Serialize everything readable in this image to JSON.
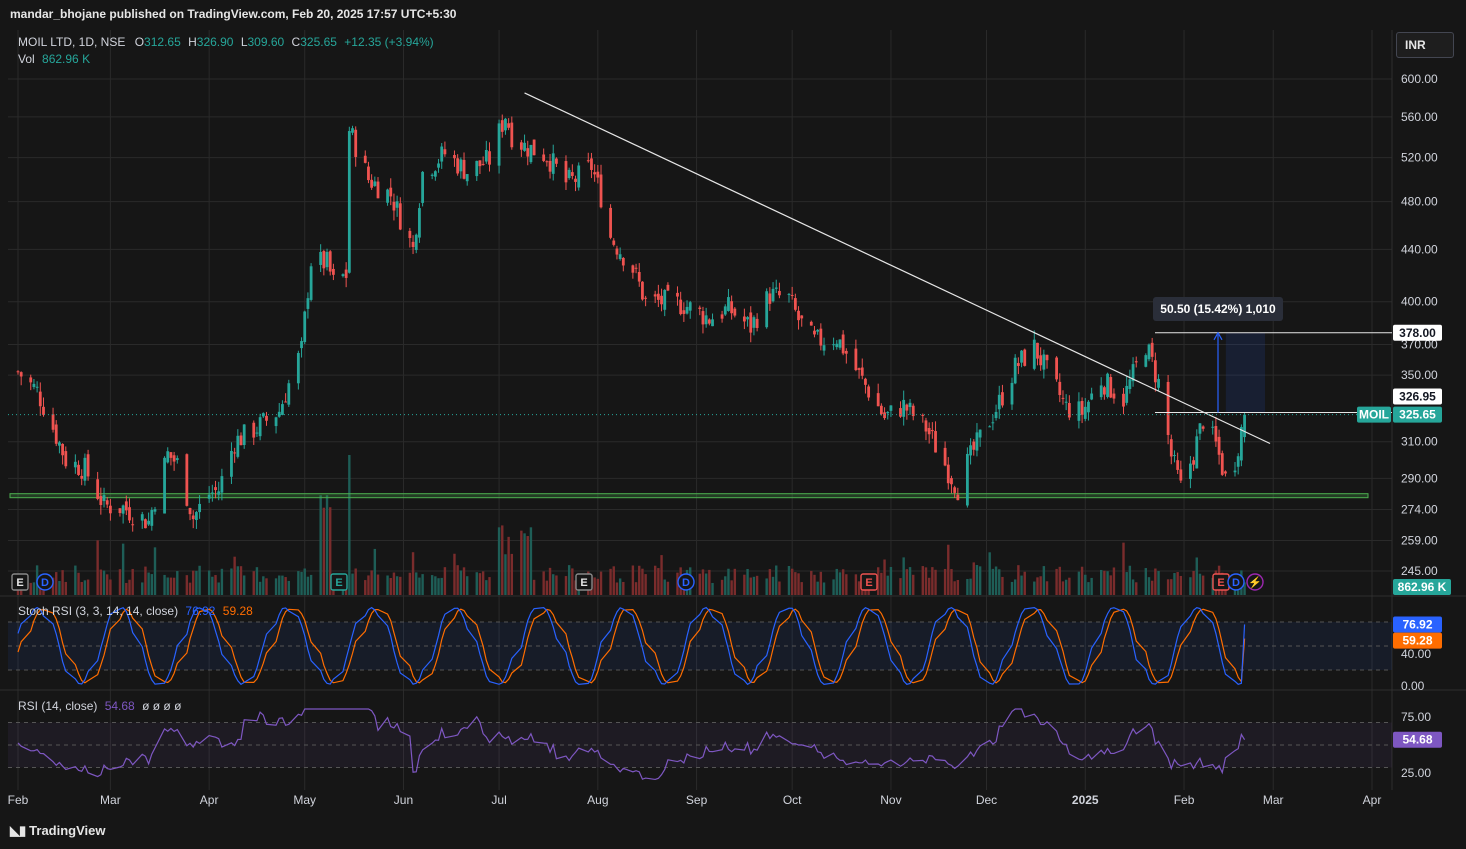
{
  "header": {
    "publisher": "mandar_bhojane published on TradingView.com, Feb 20, 2025 17:57 UTC+5:30",
    "symbol": "MOIL LTD, 1D, NSE",
    "o_label": "O",
    "o": "312.65",
    "h_label": "H",
    "h": "326.90",
    "l_label": "L",
    "l": "309.60",
    "c_label": "C",
    "c": "325.65",
    "change": "+12.35 (+3.94%)",
    "vol_label": "Vol",
    "vol": "862.96 K",
    "currency": "INR"
  },
  "colors": {
    "bg": "#161616",
    "up": "#26a69a",
    "down": "#ef5350",
    "grid": "#2a2a2a",
    "trendline": "#e6e6e6",
    "support": "#4caf50",
    "stoch_k": "#2962ff",
    "stoch_d": "#ff6d00",
    "rsi": "#7e57c2",
    "measure": "#2962ff"
  },
  "annotations": {
    "measure_label": "50.50 (15.42%) 1,010",
    "target_tag": "378.00",
    "entry_tag": "326.95",
    "symbol_tag": "MOIL",
    "last_price_tag": "325.65",
    "volume_tag": "862.96 K"
  },
  "event_markers": [
    "E",
    "D",
    "E",
    "E",
    "D",
    "E",
    "E",
    "D",
    "⚡"
  ],
  "indicators": {
    "stoch": {
      "title": "Stoch RSI (3, 3, 14, 14, close)",
      "k": "76.92",
      "d": "59.28",
      "axis": [
        "80.00",
        "40.00",
        "0.00"
      ]
    },
    "rsi": {
      "title": "RSI (14, close)",
      "value": "54.68",
      "extra": "ø ø ø ø",
      "axis": [
        "75.00",
        "25.00"
      ]
    }
  },
  "footer": {
    "brand": "TradingView"
  },
  "chart_data": {
    "type": "candlestick",
    "title": "MOIL LTD, 1D, NSE",
    "x_labels": [
      "Feb",
      "Mar",
      "Apr",
      "May",
      "Jun",
      "Jul",
      "Aug",
      "Sep",
      "Oct",
      "Nov",
      "Dec",
      "2025",
      "Feb",
      "Mar",
      "Apr"
    ],
    "y_axis_log": true,
    "y_ticks": [
      "600.00",
      "560.00",
      "520.00",
      "480.00",
      "440.00",
      "400.00",
      "370.00",
      "350.00",
      "310.00",
      "290.00",
      "274.00",
      "259.00",
      "245.00"
    ],
    "close_path": [
      [
        "2024-02-01",
        352
      ],
      [
        "2024-02-07",
        340
      ],
      [
        "2024-02-12",
        318
      ],
      [
        "2024-02-16",
        300
      ],
      [
        "2024-02-22",
        295
      ],
      [
        "2024-02-28",
        276
      ],
      [
        "2024-03-05",
        275
      ],
      [
        "2024-03-13",
        268
      ],
      [
        "2024-03-19",
        303
      ],
      [
        "2024-03-22",
        298
      ],
      [
        "2024-03-27",
        270
      ],
      [
        "2024-04-01",
        282
      ],
      [
        "2024-04-04",
        284
      ],
      [
        "2024-04-09",
        310
      ],
      [
        "2024-04-16",
        318
      ],
      [
        "2024-04-23",
        328
      ],
      [
        "2024-04-30",
        366
      ],
      [
        "2024-05-03",
        431
      ],
      [
        "2024-05-08",
        429
      ],
      [
        "2024-05-10",
        414
      ],
      [
        "2024-05-14",
        420
      ],
      [
        "2024-05-15",
        547
      ],
      [
        "2024-05-21",
        500
      ],
      [
        "2024-05-28",
        486
      ],
      [
        "2024-06-04",
        440
      ],
      [
        "2024-06-07",
        506
      ],
      [
        "2024-06-14",
        524
      ],
      [
        "2024-06-21",
        507
      ],
      [
        "2024-06-28",
        518
      ],
      [
        "2024-07-03",
        562
      ],
      [
        "2024-07-05",
        542
      ],
      [
        "2024-07-09",
        531
      ],
      [
        "2024-07-16",
        522
      ],
      [
        "2024-07-22",
        497
      ],
      [
        "2024-07-25",
        500
      ],
      [
        "2024-07-30",
        512
      ],
      [
        "2024-08-02",
        485
      ],
      [
        "2024-08-05",
        450
      ],
      [
        "2024-08-12",
        425
      ],
      [
        "2024-08-16",
        400
      ],
      [
        "2024-08-22",
        400
      ],
      [
        "2024-08-28",
        398
      ],
      [
        "2024-09-05",
        388
      ],
      [
        "2024-09-11",
        395
      ],
      [
        "2024-09-18",
        382
      ],
      [
        "2024-09-24",
        405
      ],
      [
        "2024-09-30",
        402
      ],
      [
        "2024-10-03",
        387
      ],
      [
        "2024-10-08",
        372
      ],
      [
        "2024-10-15",
        375
      ],
      [
        "2024-10-22",
        350
      ],
      [
        "2024-10-30",
        324
      ],
      [
        "2024-11-05",
        331
      ],
      [
        "2024-11-12",
        318
      ],
      [
        "2024-11-19",
        294
      ],
      [
        "2024-11-22",
        285
      ],
      [
        "2024-11-25",
        298
      ],
      [
        "2024-11-29",
        312
      ],
      [
        "2024-12-05",
        333
      ],
      [
        "2024-12-10",
        355
      ],
      [
        "2024-12-16",
        368
      ],
      [
        "2024-12-20",
        352
      ],
      [
        "2024-12-26",
        330
      ],
      [
        "2024-12-31",
        327
      ],
      [
        "2025-01-06",
        347
      ],
      [
        "2025-01-13",
        335
      ],
      [
        "2025-01-20",
        370
      ],
      [
        "2025-01-24",
        345
      ],
      [
        "2025-01-28",
        302
      ],
      [
        "2025-01-31",
        285
      ],
      [
        "2025-02-04",
        303
      ],
      [
        "2025-02-07",
        323
      ],
      [
        "2025-02-11",
        308
      ],
      [
        "2025-02-14",
        290
      ],
      [
        "2025-02-17",
        300
      ],
      [
        "2025-02-20",
        325.65
      ]
    ],
    "volume_peaks": [
      {
        "date": "2024-05-15",
        "volume": "peak"
      },
      {
        "date": "2024-05-07",
        "volume": "high"
      },
      {
        "date": "2024-07-01",
        "volume": "high"
      },
      {
        "date": "2024-07-10",
        "volume": "high"
      }
    ],
    "volume_last": 862.96,
    "trendline": [
      [
        "2024-07-09",
        585
      ],
      [
        "2025-02-28",
        309
      ]
    ],
    "support_level": 281,
    "measure": {
      "from": 326.95,
      "to": 378.0,
      "change": 50.5,
      "change_pct": 15.42,
      "bars": 1010
    },
    "stoch_rsi": {
      "k": 76.92,
      "d": 59.28,
      "bands": [
        80,
        50,
        20
      ],
      "range": [
        0,
        100
      ]
    },
    "rsi": {
      "value": 54.68,
      "bands": [
        70,
        50,
        30
      ],
      "range": [
        0,
        100
      ]
    }
  }
}
